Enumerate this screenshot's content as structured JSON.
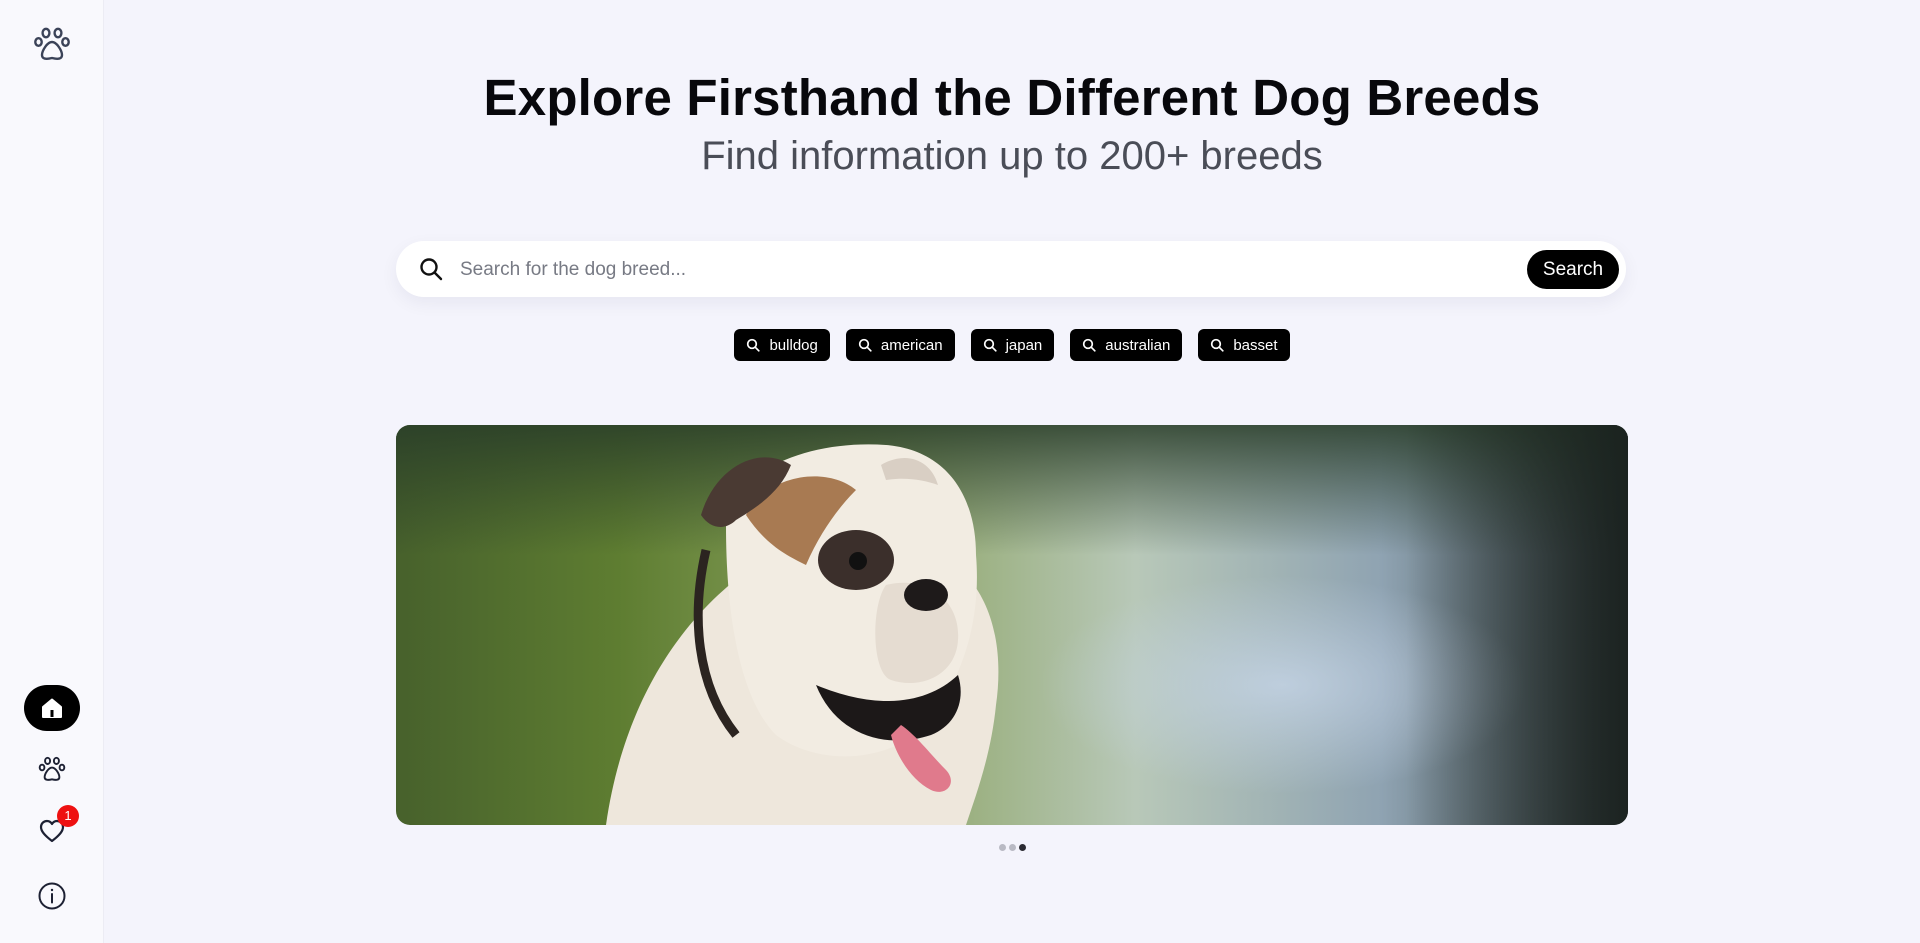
{
  "sidebar": {
    "logo_icon": "paw-outline-icon",
    "nav": [
      {
        "icon": "home-icon",
        "active": true
      },
      {
        "icon": "paw-icon",
        "active": false
      },
      {
        "icon": "heart-icon",
        "active": false,
        "badge": "1"
      },
      {
        "icon": "info-icon",
        "active": false
      }
    ]
  },
  "header": {
    "title": "Explore Firsthand the Different Dog Breeds",
    "subtitle": "Find information up to 200+ breeds"
  },
  "search": {
    "placeholder": "Search for the dog breed...",
    "value": "",
    "button_label": "Search"
  },
  "suggestions": [
    "bulldog",
    "american",
    "japan",
    "australian",
    "basset"
  ],
  "carousel": {
    "slide_count": 3,
    "active_index": 2
  },
  "colors": {
    "background": "#f4f4fc",
    "accent": "#000000",
    "badge": "#ee1111"
  }
}
